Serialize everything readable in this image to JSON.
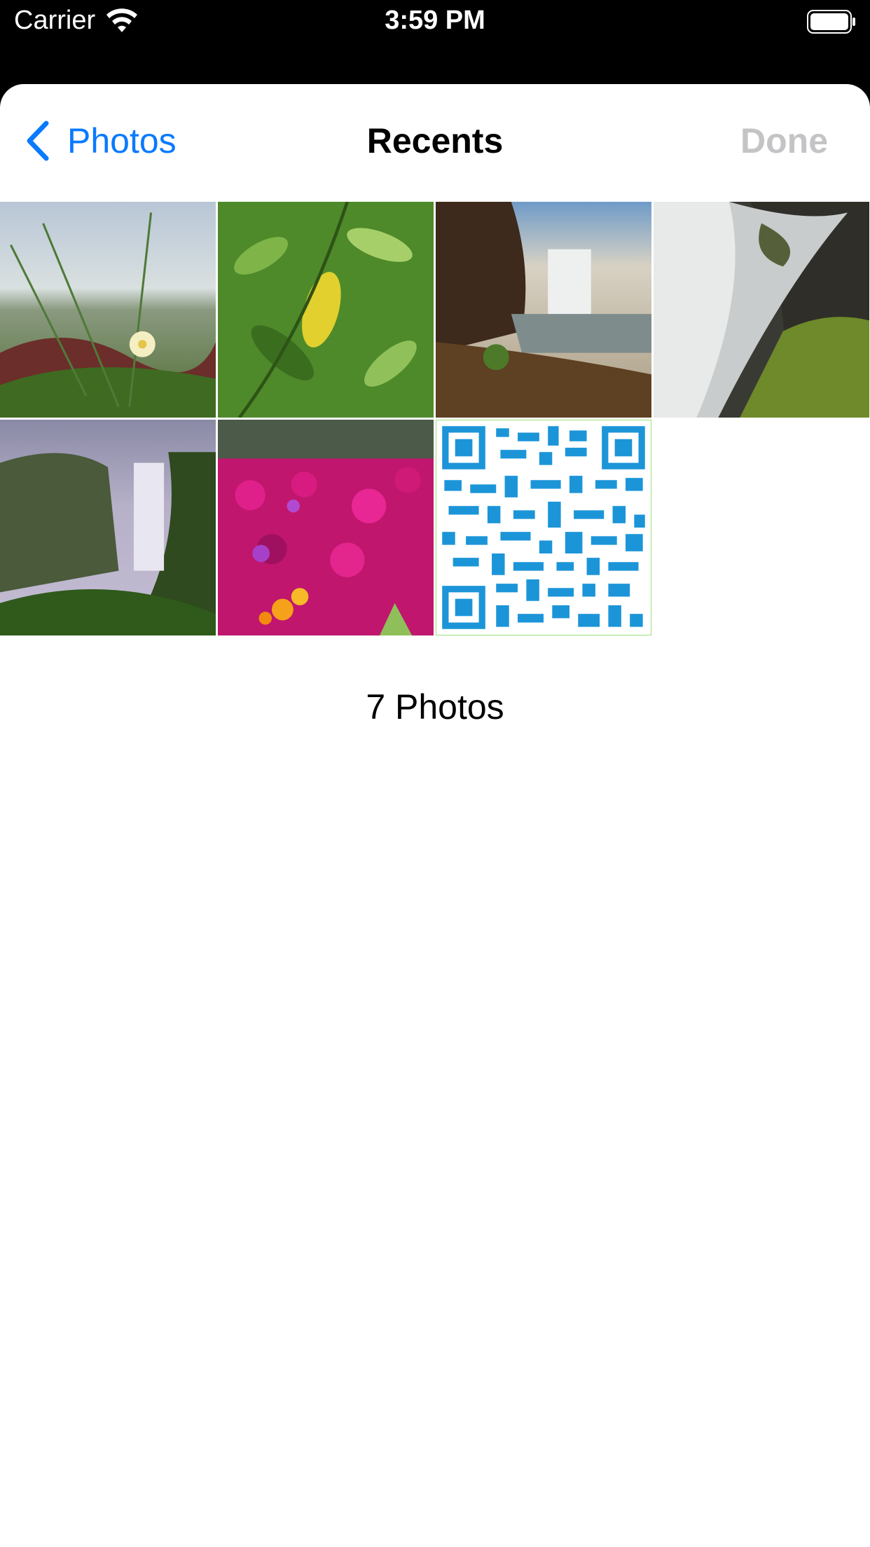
{
  "status_bar": {
    "carrier": "Carrier",
    "time": "3:59 PM",
    "icons": [
      "wifi-icon",
      "battery-icon"
    ]
  },
  "nav": {
    "back_label": "Photos",
    "title": "Recents",
    "done_label": "Done",
    "accent_color": "#0a7aff",
    "disabled_color": "#c4c4c6"
  },
  "photos": [
    {
      "subject": "beach-grass-flower"
    },
    {
      "subject": "leaves"
    },
    {
      "subject": "waterfall-cliff"
    },
    {
      "subject": "waterfall-rocks"
    },
    {
      "subject": "waterfall-valley"
    },
    {
      "subject": "pink-flowers"
    },
    {
      "subject": "qr-code"
    }
  ],
  "footer": {
    "count_label": "7 Photos"
  }
}
